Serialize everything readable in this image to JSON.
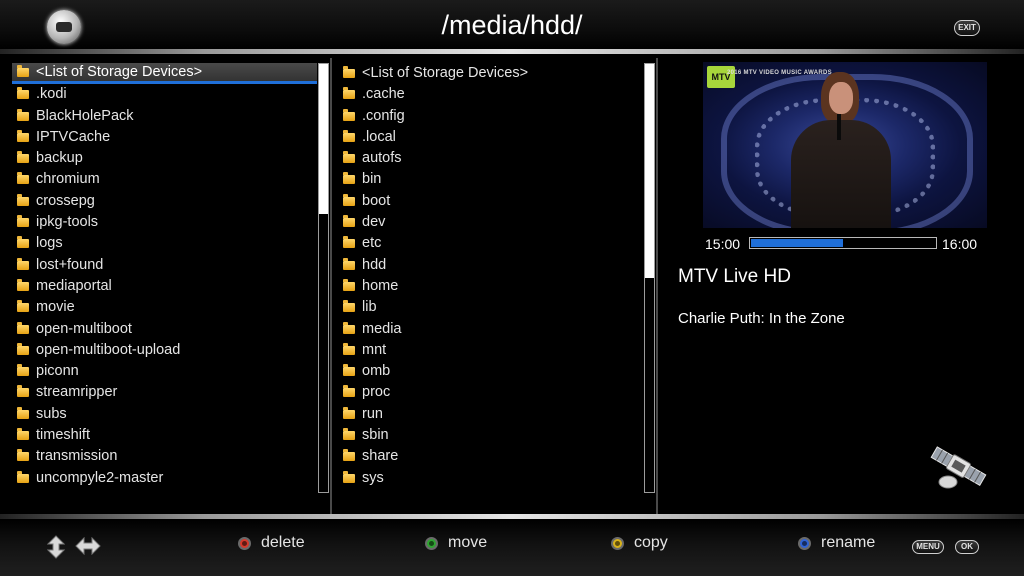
{
  "header": {
    "title": "/media/hdd/",
    "exit_key": "EXIT"
  },
  "left_list": {
    "items": [
      "<List of Storage Devices>",
      ".kodi",
      "BlackHolePack",
      "IPTVCache",
      "backup",
      "chromium",
      "crossepg",
      "ipkg-tools",
      "logs",
      "lost+found",
      "mediaportal",
      "movie",
      "open-multiboot",
      "open-multiboot-upload",
      "piconn",
      "streamripper",
      "subs",
      "timeshift",
      "transmission",
      "uncompyle2-master"
    ],
    "selected_index": 0,
    "scroll_position": 0.0,
    "scroll_visible": 0.35
  },
  "right_list": {
    "items": [
      "<List of Storage Devices>",
      ".cache",
      ".config",
      ".local",
      "autofs",
      "bin",
      "boot",
      "dev",
      "etc",
      "hdd",
      "home",
      "lib",
      "media",
      "mnt",
      "omb",
      "proc",
      "run",
      "sbin",
      "share",
      "sys"
    ],
    "scroll_position": 0.0,
    "scroll_visible": 0.5
  },
  "preview": {
    "channel_logo": "MTV",
    "event_tag": "2016 MTV VIDEO MUSIC AWARDS",
    "start_time": "15:00",
    "end_time": "16:00",
    "progress": 0.5,
    "channel": "MTV Live HD",
    "program": "Charlie Puth: In the Zone"
  },
  "footer": {
    "delete": {
      "label": "delete",
      "color": "#d63a2c"
    },
    "move": {
      "label": "move",
      "color": "#2fa531"
    },
    "copy": {
      "label": "copy",
      "color": "#d9b21a"
    },
    "rename": {
      "label": "rename",
      "color": "#2f63d6"
    },
    "menu_key": "MENU",
    "ok_key": "OK"
  },
  "colors": {
    "accent": "#1f6fd9",
    "folder": "#f0b83a"
  }
}
